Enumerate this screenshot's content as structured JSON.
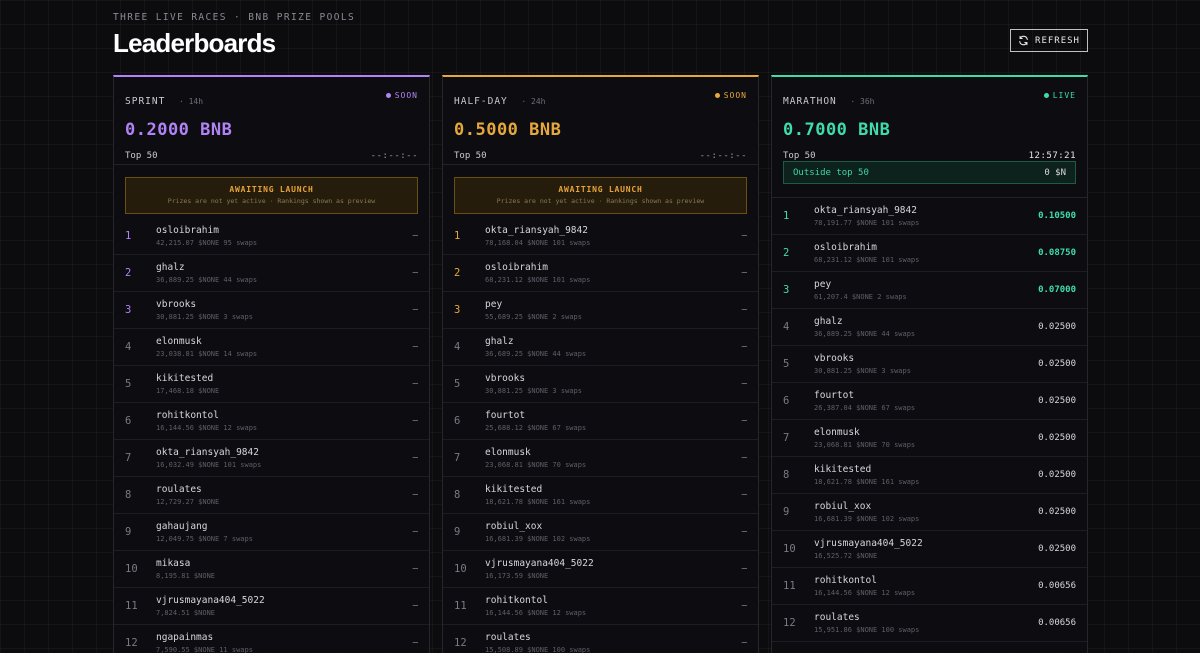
{
  "header": {
    "eyebrow": "THREE LIVE RACES · BNB PRIZE POOLS",
    "title": "Leaderboards",
    "refresh_label": "REFRESH"
  },
  "colors": {
    "sprint": "#b084f5",
    "halfday": "#e7a83b",
    "marathon": "#3fdcaa",
    "awaiting_notice": "#e8a43a"
  },
  "races": [
    {
      "key": "sprint",
      "name": "SPRINT",
      "duration": "14h",
      "status": "SOON",
      "pool": "0.2000 BNB",
      "top_label": "Top 50",
      "timer": "--:--:--",
      "notice_title": "AWAITING LAUNCH",
      "notice_sub": "Prizes are not yet active · Rankings shown as preview",
      "rows": [
        {
          "rank": "1",
          "name": "osloibrahim",
          "meta": "42,215.07 $NONE 95 swaps",
          "prize": "—"
        },
        {
          "rank": "2",
          "name": "ghalz",
          "meta": "36,889.25 $NONE 44 swaps",
          "prize": "—"
        },
        {
          "rank": "3",
          "name": "vbrooks",
          "meta": "30,881.25 $NONE 3 swaps",
          "prize": "—"
        },
        {
          "rank": "4",
          "name": "elonmusk",
          "meta": "23,038.81 $NONE 14 swaps",
          "prize": "—"
        },
        {
          "rank": "5",
          "name": "kikitested",
          "meta": "17,468.18 $NONE",
          "prize": "—"
        },
        {
          "rank": "6",
          "name": "rohitkontol",
          "meta": "16,144.56 $NONE 12 swaps",
          "prize": "—"
        },
        {
          "rank": "7",
          "name": "okta_riansyah_9842",
          "meta": "16,032.49 $NONE 101 swaps",
          "prize": "—"
        },
        {
          "rank": "8",
          "name": "roulates",
          "meta": "12,729.27 $NONE",
          "prize": "—"
        },
        {
          "rank": "9",
          "name": "gahaujang",
          "meta": "12,049.75 $NONE 7 swaps",
          "prize": "—"
        },
        {
          "rank": "10",
          "name": "mikasa",
          "meta": "8,195.81 $NONE",
          "prize": "—"
        },
        {
          "rank": "11",
          "name": "vjrusmayana404_5022",
          "meta": "7,824.51 $NONE",
          "prize": "—"
        },
        {
          "rank": "12",
          "name": "ngapainmas",
          "meta": "7,590.55 $NONE 11 swaps",
          "prize": "—"
        }
      ]
    },
    {
      "key": "halfday",
      "name": "HALF-DAY",
      "duration": "24h",
      "status": "SOON",
      "pool": "0.5000 BNB",
      "top_label": "Top 50",
      "timer": "--:--:--",
      "notice_title": "AWAITING LAUNCH",
      "notice_sub": "Prizes are not yet active · Rankings shown as preview",
      "rows": [
        {
          "rank": "1",
          "name": "okta_riansyah_9842",
          "meta": "78,168.04 $NONE 101 swaps",
          "prize": "—"
        },
        {
          "rank": "2",
          "name": "osloibrahim",
          "meta": "68,231.12 $NONE 101 swaps",
          "prize": "—"
        },
        {
          "rank": "3",
          "name": "pey",
          "meta": "55,689.25 $NONE 2 swaps",
          "prize": "—"
        },
        {
          "rank": "4",
          "name": "ghalz",
          "meta": "36,689.25 $NONE 44 swaps",
          "prize": "—"
        },
        {
          "rank": "5",
          "name": "vbrooks",
          "meta": "30,881.25 $NONE 3 swaps",
          "prize": "—"
        },
        {
          "rank": "6",
          "name": "fourtot",
          "meta": "25,688.12 $NONE 67 swaps",
          "prize": "—"
        },
        {
          "rank": "7",
          "name": "elonmusk",
          "meta": "23,068.81 $NONE 70 swaps",
          "prize": "—"
        },
        {
          "rank": "8",
          "name": "kikitested",
          "meta": "18,621.78 $NONE 161 swaps",
          "prize": "—"
        },
        {
          "rank": "9",
          "name": "robiul_xox",
          "meta": "16,681.39 $NONE 102 swaps",
          "prize": "—"
        },
        {
          "rank": "10",
          "name": "vjrusmayana404_5022",
          "meta": "16,173.59 $NONE",
          "prize": "—"
        },
        {
          "rank": "11",
          "name": "rohitkontol",
          "meta": "16,144.56 $NONE 12 swaps",
          "prize": "—"
        },
        {
          "rank": "12",
          "name": "roulates",
          "meta": "15,508.89 $NONE 100 swaps",
          "prize": "—"
        }
      ]
    },
    {
      "key": "marathon",
      "name": "MARATHON",
      "duration": "36h",
      "status": "LIVE",
      "pool": "0.7000 BNB",
      "top_label": "Top 50",
      "timer": "12:57:21",
      "outside_label": "Outside top 50",
      "outside_value": "0 $N",
      "rows": [
        {
          "rank": "1",
          "name": "okta_riansyah_9842",
          "meta": "78,191.77 $NONE 101 swaps",
          "prize": "0.10500"
        },
        {
          "rank": "2",
          "name": "osloibrahim",
          "meta": "68,231.12 $NONE 101 swaps",
          "prize": "0.08750"
        },
        {
          "rank": "3",
          "name": "pey",
          "meta": "61,207.4 $NONE 2 swaps",
          "prize": "0.07000"
        },
        {
          "rank": "4",
          "name": "ghalz",
          "meta": "36,889.25 $NONE 44 swaps",
          "prize": "0.02500"
        },
        {
          "rank": "5",
          "name": "vbrooks",
          "meta": "30,881.25 $NONE 3 swaps",
          "prize": "0.02500"
        },
        {
          "rank": "6",
          "name": "fourtot",
          "meta": "26,387.04 $NONE 67 swaps",
          "prize": "0.02500"
        },
        {
          "rank": "7",
          "name": "elonmusk",
          "meta": "23,068.81 $NONE 70 swaps",
          "prize": "0.02500"
        },
        {
          "rank": "8",
          "name": "kikitested",
          "meta": "18,621.78 $NONE 161 swaps",
          "prize": "0.02500"
        },
        {
          "rank": "9",
          "name": "robiul_xox",
          "meta": "16,681.39 $NONE 102 swaps",
          "prize": "0.02500"
        },
        {
          "rank": "10",
          "name": "vjrusmayana404_5022",
          "meta": "16,525.72 $NONE",
          "prize": "0.02500"
        },
        {
          "rank": "11",
          "name": "rohitkontol",
          "meta": "16,144.56 $NONE 12 swaps",
          "prize": "0.00656"
        },
        {
          "rank": "12",
          "name": "roulates",
          "meta": "15,951.86 $NONE 100 swaps",
          "prize": "0.00656"
        }
      ]
    }
  ]
}
